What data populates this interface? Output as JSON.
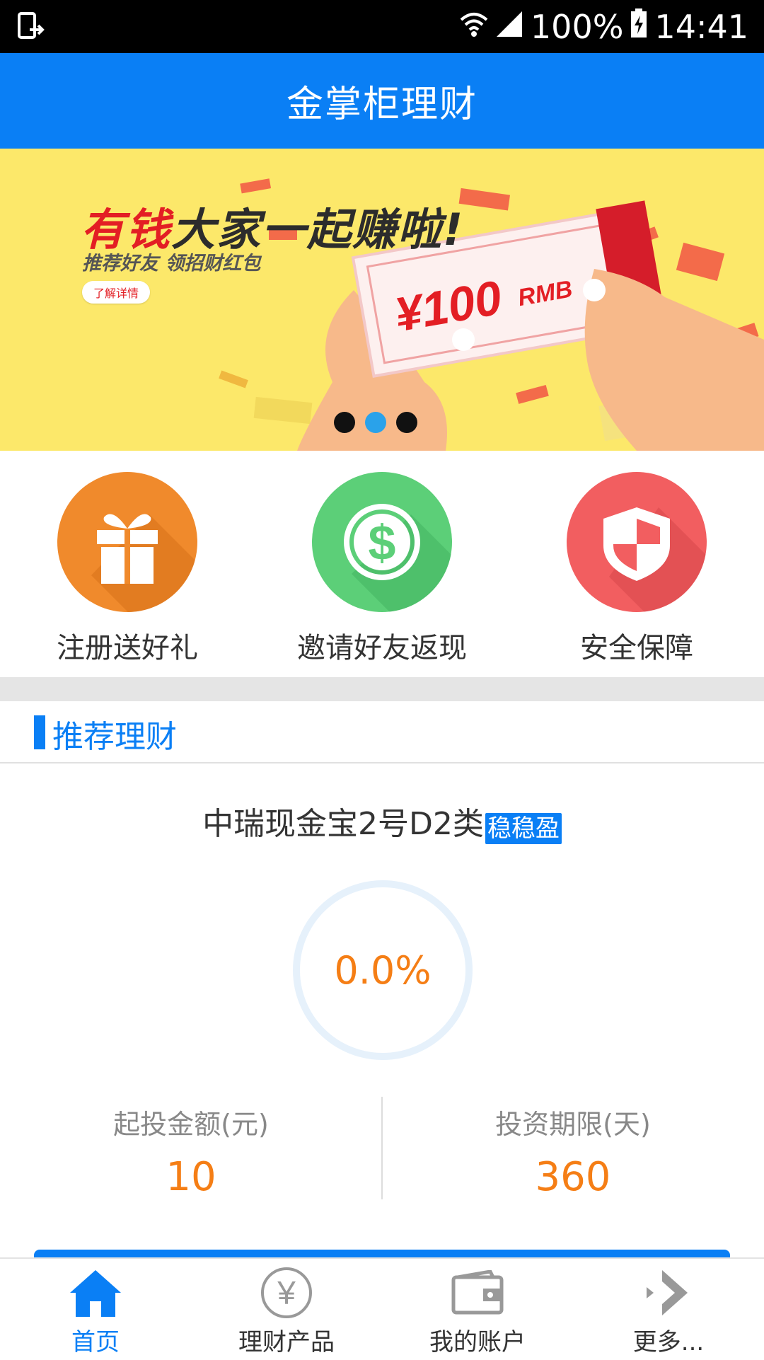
{
  "status_bar": {
    "battery": "100%",
    "time": "14:41"
  },
  "header": {
    "title": "金掌柜理财"
  },
  "banner": {
    "title_red": "有钱",
    "title_rest": "大家一起赚啦!",
    "subtitle": "推荐好友 领招财红包",
    "details_button": "了解详情",
    "ticket_amount": "¥100",
    "ticket_unit": "RMB",
    "slides": 3,
    "active_slide": 2
  },
  "features": [
    {
      "label": "注册送好礼",
      "icon": "gift-icon",
      "color": "#f08a2c"
    },
    {
      "label": "邀请好友返现",
      "icon": "dollar-icon",
      "color": "#5ccf78"
    },
    {
      "label": "安全保障",
      "icon": "shield-icon",
      "color": "#f25e60"
    }
  ],
  "section": {
    "title": "推荐理财"
  },
  "product": {
    "name": "中瑞现金宝2号D2类",
    "tag": "稳稳盈",
    "progress_text": "0.0%",
    "progress_value": 0.0,
    "min_invest_label": "起投金额(元)",
    "min_invest_value": "10",
    "term_label": "投资期限(天)",
    "term_value": "360"
  },
  "tabbar": {
    "active": "home",
    "items": [
      {
        "label": "首页",
        "icon": "home-icon"
      },
      {
        "label": "理财产品",
        "icon": "yen-icon"
      },
      {
        "label": "我的账户",
        "icon": "wallet-icon"
      },
      {
        "label": "更多...",
        "icon": "more-icon"
      }
    ]
  },
  "colors": {
    "primary": "#0a7ff5",
    "accent_orange": "#f57e15",
    "banner_bg": "#fce86a"
  }
}
